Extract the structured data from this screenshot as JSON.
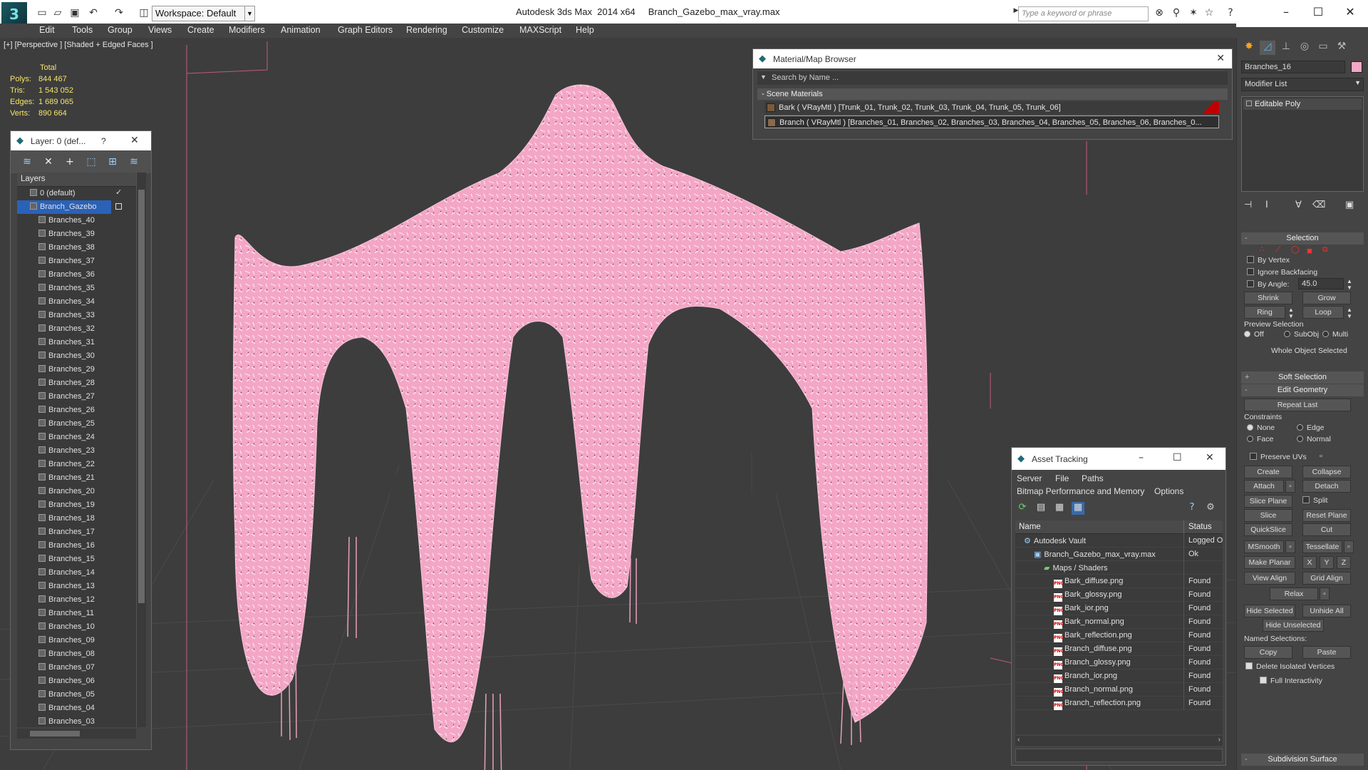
{
  "title_bar": {
    "workspace": "Workspace: Default",
    "app_title": "Autodesk 3ds Max  2014 x64     Branch_Gazebo_max_vray.max",
    "search_placeholder": "Type a keyword or phrase"
  },
  "menu": [
    "Edit",
    "Tools",
    "Group",
    "Views",
    "Create",
    "Modifiers",
    "Animation",
    "Graph Editors",
    "Rendering",
    "Customize",
    "MAXScript",
    "Help"
  ],
  "viewport": {
    "label": "[+] [Perspective ] [Shaded + Edged Faces ]",
    "stats": {
      "header": "Total",
      "rows": [
        {
          "k": "Polys:",
          "v": "844 467"
        },
        {
          "k": "Tris:",
          "v": "1 543 052"
        },
        {
          "k": "Edges:",
          "v": "1 689 065"
        },
        {
          "k": "Verts:",
          "v": "890 664"
        }
      ]
    },
    "object_color": "#f4a6c6"
  },
  "layer_dialog": {
    "title": "Layer: 0 (def...",
    "help": "?",
    "header": "Layers",
    "rows": [
      "0 (default)",
      "Branch_Gazebo",
      "Branches_40",
      "Branches_39",
      "Branches_38",
      "Branches_37",
      "Branches_36",
      "Branches_35",
      "Branches_34",
      "Branches_33",
      "Branches_32",
      "Branches_31",
      "Branches_30",
      "Branches_29",
      "Branches_28",
      "Branches_27",
      "Branches_26",
      "Branches_25",
      "Branches_24",
      "Branches_23",
      "Branches_22",
      "Branches_21",
      "Branches_20",
      "Branches_19",
      "Branches_18",
      "Branches_17",
      "Branches_16",
      "Branches_15",
      "Branches_14",
      "Branches_13",
      "Branches_12",
      "Branches_11",
      "Branches_10",
      "Branches_09",
      "Branches_08",
      "Branches_07",
      "Branches_06",
      "Branches_05",
      "Branches_04",
      "Branches_03"
    ]
  },
  "material_browser": {
    "title": "Material/Map Browser",
    "search": "Search by Name ...",
    "group": "- Scene Materials",
    "rows": [
      "Bark  ( VRayMtl )  [Trunk_01, Trunk_02, Trunk_03, Trunk_04, Trunk_05, Trunk_06]",
      "Branch  ( VRayMtl )  [Branches_01, Branches_02, Branches_03, Branches_04, Branches_05, Branches_06, Branches_0..."
    ]
  },
  "asset_tracking": {
    "title": "Asset Tracking",
    "menu1": [
      "Server",
      "File",
      "Paths"
    ],
    "menu2": [
      "Bitmap Performance and Memory",
      "Options"
    ],
    "col_name": "Name",
    "col_status": "Status",
    "rows": [
      {
        "name": "Autodesk Vault",
        "status": "Logged O"
      },
      {
        "name": "Branch_Gazebo_max_vray.max",
        "status": "Ok"
      },
      {
        "name": "Maps / Shaders",
        "status": ""
      },
      {
        "name": "Bark_diffuse.png",
        "status": "Found"
      },
      {
        "name": "Bark_glossy.png",
        "status": "Found"
      },
      {
        "name": "Bark_ior.png",
        "status": "Found"
      },
      {
        "name": "Bark_normal.png",
        "status": "Found"
      },
      {
        "name": "Bark_reflection.png",
        "status": "Found"
      },
      {
        "name": "Branch_diffuse.png",
        "status": "Found"
      },
      {
        "name": "Branch_glossy.png",
        "status": "Found"
      },
      {
        "name": "Branch_ior.png",
        "status": "Found"
      },
      {
        "name": "Branch_normal.png",
        "status": "Found"
      },
      {
        "name": "Branch_reflection.png",
        "status": "Found"
      }
    ]
  },
  "command_panel": {
    "object_name": "Branches_16",
    "modifier_list": "Modifier List",
    "stack_item": "Editable Poly",
    "selection": "Selection",
    "by_vertex": "By Vertex",
    "ignore_backfacing": "Ignore Backfacing",
    "by_angle": "By Angle:",
    "angle_value": "45.0",
    "shrink": "Shrink",
    "grow": "Grow",
    "ring": "Ring",
    "loop": "Loop",
    "preview_selection": "Preview Selection",
    "off": "Off",
    "subobj": "SubObj",
    "multi": "Multi",
    "whole_object": "Whole Object Selected",
    "soft_selection": "Soft Selection",
    "edit_geometry": "Edit Geometry",
    "repeat_last": "Repeat Last",
    "constraints": "Constraints",
    "none": "None",
    "edge": "Edge",
    "face": "Face",
    "normal": "Normal",
    "preserve_uvs": "Preserve UVs",
    "create": "Create",
    "collapse": "Collapse",
    "attach": "Attach",
    "detach": "Detach",
    "slice_plane": "Slice Plane",
    "split": "Split",
    "slice": "Slice",
    "reset_plane": "Reset Plane",
    "quickslice": "QuickSlice",
    "cut": "Cut",
    "msmooth": "MSmooth",
    "tessellate": "Tessellate",
    "make_planar": "Make Planar",
    "x": "X",
    "y": "Y",
    "z": "Z",
    "view_align": "View Align",
    "grid_align": "Grid Align",
    "relax": "Relax",
    "hide_selected": "Hide Selected",
    "unhide_all": "Unhide All",
    "hide_unselected": "Hide Unselected",
    "named_selections": "Named Selections:",
    "copy": "Copy",
    "paste": "Paste",
    "delete_isolated": "Delete Isolated Vertices",
    "full_interactivity": "Full Interactivity",
    "subdivision_surface": "Subdivision Surface"
  }
}
